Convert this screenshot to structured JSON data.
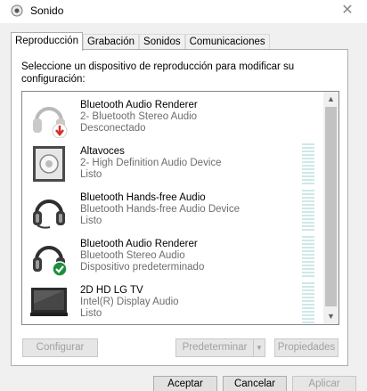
{
  "window": {
    "title": "Sonido"
  },
  "tabs": [
    {
      "label": "Reproducción",
      "active": true
    },
    {
      "label": "Grabación",
      "active": false
    },
    {
      "label": "Sonidos",
      "active": false
    },
    {
      "label": "Comunicaciones",
      "active": false
    }
  ],
  "prompt": "Seleccione un dispositivo de reproducción para modificar su configuración:",
  "devices": [
    {
      "name": "Bluetooth Audio Renderer",
      "description": "2- Bluetooth Stereo Audio",
      "status": "Desconectado",
      "icon": "headphones-disconnected-icon",
      "badge": "red-down-arrow"
    },
    {
      "name": "Altavoces",
      "description": "2- High Definition Audio Device",
      "status": "Listo",
      "icon": "speaker-icon"
    },
    {
      "name": "Bluetooth Hands-free Audio",
      "description": "Bluetooth Hands-free Audio Device",
      "status": "Listo",
      "icon": "headset-icon"
    },
    {
      "name": "Bluetooth Audio Renderer",
      "description": "Bluetooth Stereo Audio",
      "status": "Dispositivo predeterminado",
      "icon": "headphones-default-icon",
      "badge": "green-check"
    },
    {
      "name": "2D HD LG TV",
      "description": "Intel(R) Display Audio",
      "status": "Listo",
      "icon": "monitor-icon"
    }
  ],
  "buttons": {
    "configure": "Configurar",
    "set_default": "Predeterminar",
    "properties": "Propiedades",
    "accept": "Aceptar",
    "cancel": "Cancelar",
    "apply": "Aplicar"
  },
  "colors": {
    "accent": "#0078d7",
    "disconnected_badge": "#d32f2f",
    "default_badge": "#1e8e3e",
    "level_meter": "#cde8e8"
  }
}
